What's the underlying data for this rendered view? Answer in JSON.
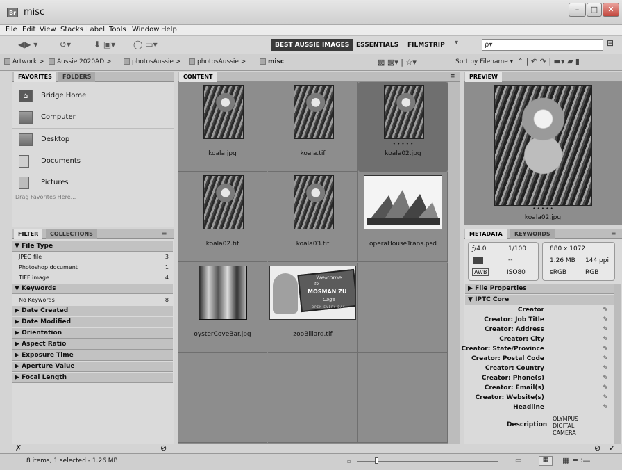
{
  "window": {
    "title": "misc",
    "app_icon": "Br",
    "controls": [
      "–",
      "□",
      "✕"
    ]
  },
  "menu": [
    "File",
    "Edit",
    "View",
    "Stacks",
    "Label",
    "Tools",
    "Window",
    "Help"
  ],
  "workspaces": {
    "active": "BEST AUSSIE IMAGES",
    "others": [
      "ESSENTIALS",
      "FILMSTRIP"
    ]
  },
  "search": {
    "value": "ρ▾"
  },
  "breadcrumb": [
    "Artwork",
    "Aussie 2020AD",
    "photosAussie",
    "photosAussie",
    "misc"
  ],
  "sort": {
    "label": "Sort by Filename ▾"
  },
  "panels": {
    "favorites_tab": "FAVORITES",
    "folders_tab": "FOLDERS",
    "content_tab": "CONTENT",
    "preview_tab": "PREVIEW",
    "filter_tab": "FILTER",
    "collections_tab": "COLLECTIONS",
    "metadata_tab": "METADATA",
    "keywords_tab": "KEYWORDS"
  },
  "favorites": [
    {
      "label": "Bridge Home",
      "icon": "home-icon"
    },
    {
      "label": "Computer",
      "icon": "computer-icon"
    },
    {
      "label": "Desktop",
      "icon": "desktop-icon"
    },
    {
      "label": "Documents",
      "icon": "documents-icon"
    },
    {
      "label": "Pictures",
      "icon": "pictures-icon"
    }
  ],
  "favorites_hint": "Drag Favorites Here...",
  "filter": {
    "file_type": {
      "title": "File Type",
      "rows": [
        {
          "label": "JPEG file",
          "count": "3"
        },
        {
          "label": "Photoshop document",
          "count": "1"
        },
        {
          "label": "TIFF image",
          "count": "4"
        }
      ]
    },
    "keywords": {
      "title": "Keywords",
      "rows": [
        {
          "label": "No Keywords",
          "count": "8"
        }
      ]
    },
    "collapsed": [
      "Date Created",
      "Date Modified",
      "Orientation",
      "Aspect Ratio",
      "Exposure Time",
      "Aperture Value",
      "Focal Length"
    ]
  },
  "thumbnails": [
    {
      "name": "koala.jpg",
      "kind": "koala"
    },
    {
      "name": "koala.tif",
      "kind": "koala"
    },
    {
      "name": "koala02.jpg",
      "kind": "koala",
      "selected": true,
      "rating": "• • • • •"
    },
    {
      "name": "koala02.tif",
      "kind": "koala"
    },
    {
      "name": "koala03.tif",
      "kind": "koala"
    },
    {
      "name": "operaHouseTrans.psd",
      "kind": "opera"
    },
    {
      "name": "oysterCoveBar.jpg",
      "kind": "oyster"
    },
    {
      "name": "zooBillard.tif",
      "kind": "zoo",
      "sign_lines": [
        "Welcome",
        "to",
        "MOSMAN ZU",
        "Cage",
        "OPEN EVERY DAY"
      ]
    }
  ],
  "preview": {
    "filename": "koala02.jpg",
    "rating": "• • • • •"
  },
  "metadata": {
    "fstop": "ƒ/4.0",
    "shutter": "1/100",
    "dimensions": "880 x 1072",
    "exposure_comp": "--",
    "filesize": "1.26 MB",
    "ppi": "144 ppi",
    "wb": "AWB",
    "iso": "ISO80",
    "colorspace": "sRGB",
    "mode": "RGB",
    "file_properties": "File Properties",
    "iptc": "IPTC Core",
    "fields": [
      "Creator",
      "Creator: Job Title",
      "Creator: Address",
      "Creator: City",
      "Creator: State/Province",
      "Creator: Postal Code",
      "Creator: Country",
      "Creator: Phone(s)",
      "Creator: Email(s)",
      "Creator: Website(s)",
      "Headline"
    ],
    "description_label": "Description",
    "description_value": "OLYMPUS DIGITAL CAMERA"
  },
  "status": {
    "text": "8 items, 1 selected - 1.26 MB"
  }
}
